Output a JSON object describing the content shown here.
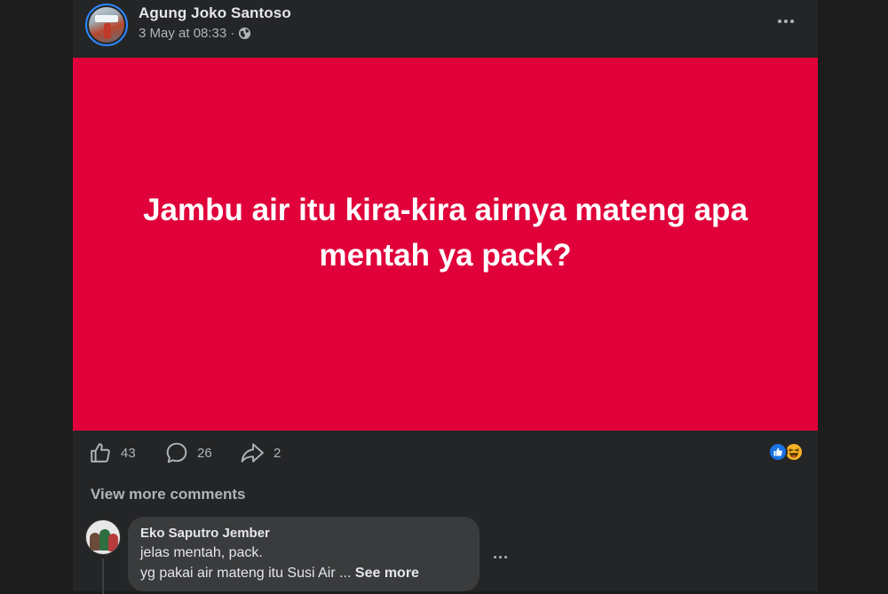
{
  "post": {
    "author": "Agung Joko Santoso",
    "timestamp": "3 May at 08:33 ·",
    "privacy_icon": "globe-icon",
    "menu_icon": "more-horizontal-icon",
    "banner": {
      "text": "Jambu air itu kira-kira airnya mateng apa mentah ya pack?",
      "background_color": "#e0003a",
      "text_color": "#ffffff"
    },
    "actions": {
      "like_count": "43",
      "comment_count": "26",
      "share_count": "2"
    },
    "reactions": [
      "like-reaction-icon",
      "haha-reaction-icon"
    ]
  },
  "comments_section": {
    "view_more_label": "View more comments",
    "comments": [
      {
        "author": "Eko Saputro Jember",
        "line1": "jelas mentah, pack.",
        "line2": "yg pakai air mateng itu Susi Air ...",
        "see_more_label": "See more"
      }
    ]
  },
  "colors": {
    "page_bg": "#1c1c1d",
    "card_bg": "#242526",
    "bubble_bg": "#3a3b3c",
    "accent_blue": "#1b74e4",
    "text_primary": "#e4e6eb",
    "text_secondary": "#b0b3b8"
  }
}
